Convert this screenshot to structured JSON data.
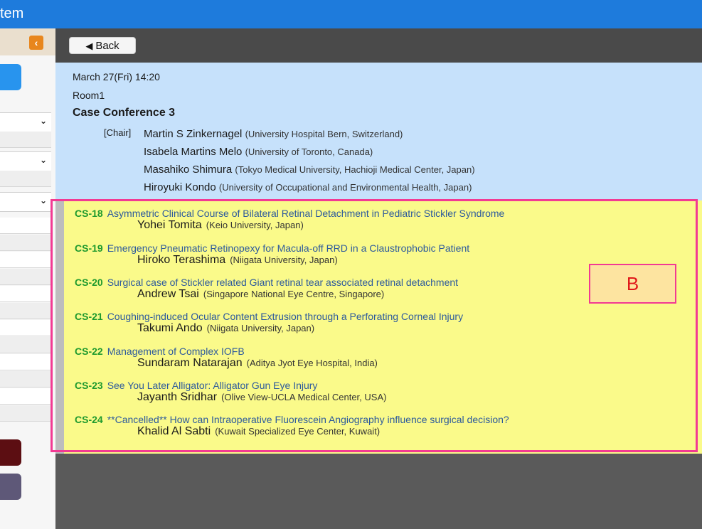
{
  "app": {
    "title": "tem"
  },
  "sidebar": {
    "collapse_glyph": "‹"
  },
  "toolbar": {
    "back_label": "Back",
    "back_icon": "◀"
  },
  "session": {
    "datetime": "March 27(Fri) 14:20",
    "room": "Room1",
    "title": "Case Conference 3",
    "chair_tag": "[Chair]",
    "chairs": [
      {
        "name": "Martin S Zinkernagel",
        "affiliation": "(University Hospital Bern, Switzerland)"
      },
      {
        "name": "Isabela Martins Melo",
        "affiliation": "(University of Toronto, Canada)"
      },
      {
        "name": "Masahiko Shimura",
        "affiliation": "(Tokyo Medical University, Hachioji Medical Center, Japan)"
      },
      {
        "name": "Hiroyuki Kondo",
        "affiliation": "(University of Occupational and Environmental Health, Japan)"
      }
    ]
  },
  "presentations": [
    {
      "code": "CS-18",
      "title": "Asymmetric Clinical Course of Bilateral Retinal Detachment in Pediatric Stickler Syndrome",
      "presenter": "Yohei Tomita",
      "affiliation": "(Keio University, Japan)"
    },
    {
      "code": "CS-19",
      "title": "Emergency Pneumatic Retinopexy for Macula-off RRD in a Claustrophobic Patient",
      "presenter": "Hiroko Terashima",
      "affiliation": "(Niigata University, Japan)"
    },
    {
      "code": "CS-20",
      "title": "Surgical case of Stickler related Giant retinal tear associated retinal detachment",
      "presenter": "Andrew Tsai",
      "affiliation": "(Singapore National Eye Centre, Singapore)"
    },
    {
      "code": "CS-21",
      "title": "Coughing-induced Ocular Content Extrusion through a Perforating Corneal Injury",
      "presenter": "Takumi Ando",
      "affiliation": "(Niigata University, Japan)"
    },
    {
      "code": "CS-22",
      "title": "Management of Complex IOFB",
      "presenter": "Sundaram Natarajan",
      "affiliation": "(Aditya Jyot Eye Hospital, India)"
    },
    {
      "code": "CS-23",
      "title": "See You Later Alligator: Alligator Gun Eye Injury",
      "presenter": "Jayanth Sridhar",
      "affiliation": "(Olive View-UCLA Medical Center, USA)"
    },
    {
      "code": "CS-24",
      "title": "**Cancelled** How can Intraoperative Fluorescein Angiography influence surgical decision?",
      "presenter": "Khalid Al Sabti",
      "affiliation": "(Kuwait Specialized Eye Center, Kuwait)"
    }
  ],
  "annotation": {
    "label": "B"
  },
  "colors": {
    "topbar": "#1e7bdc",
    "session_bg": "#c6e1fb",
    "presentations_bg": "#fafa8a",
    "highlight_border": "#f23a93",
    "code_green": "#1f9a2e",
    "title_blue": "#2d5a9c"
  }
}
